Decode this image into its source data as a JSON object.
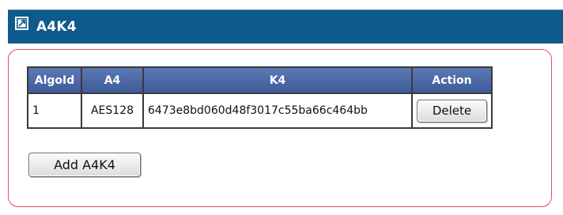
{
  "header": {
    "title": "A4K4",
    "icon": "window-icon"
  },
  "table": {
    "columns": [
      "AlgoId",
      "A4",
      "K4",
      "Action"
    ],
    "rows": [
      {
        "algo_id": "1",
        "a4": "AES128",
        "k4": "6473e8bd060d48f3017c55ba66c464bb",
        "action_label": "Delete"
      }
    ]
  },
  "buttons": {
    "add_label": "Add A4K4"
  },
  "colors": {
    "header_bg": "#0e5a8c",
    "table_header_bg": "#4a68a7",
    "panel_border": "#e0505a"
  }
}
